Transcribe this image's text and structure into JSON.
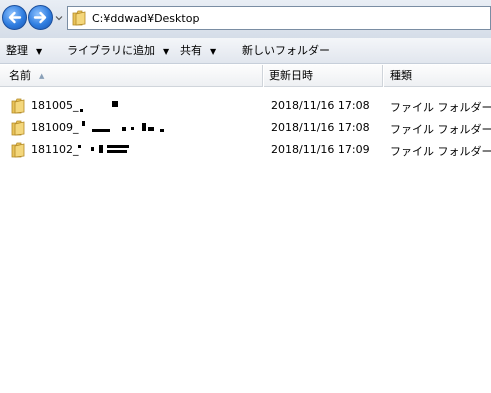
{
  "address": {
    "path": "C:¥ddwad¥Desktop"
  },
  "nav": {
    "back_icon": "back-arrow-icon",
    "forward_icon": "forward-arrow-icon",
    "history_icon": "chevron-down-icon"
  },
  "toolbar": {
    "organize": "整理",
    "include_library": "ライブラリに追加",
    "share": "共有",
    "new_folder": "新しいフォルダー",
    "dropdown_arrow": "▼"
  },
  "columns": {
    "name": "名前",
    "date": "更新日時",
    "type": "種類"
  },
  "files": [
    {
      "name": "181005_",
      "modified": "2018/11/16 17:08",
      "type": "ファイル フォルダー",
      "icon": "folder-icon"
    },
    {
      "name": "181009_",
      "modified": "2018/11/16 17:08",
      "type": "ファイル フォルダー",
      "icon": "folder-icon"
    },
    {
      "name": "181102_",
      "modified": "2018/11/16 17:09",
      "type": "ファイル フォルダー",
      "icon": "folder-icon"
    }
  ],
  "colors": {
    "accent": "#2f7de0",
    "folder": "#e8c25a",
    "toolbar_bg": "#e1e6ee"
  }
}
